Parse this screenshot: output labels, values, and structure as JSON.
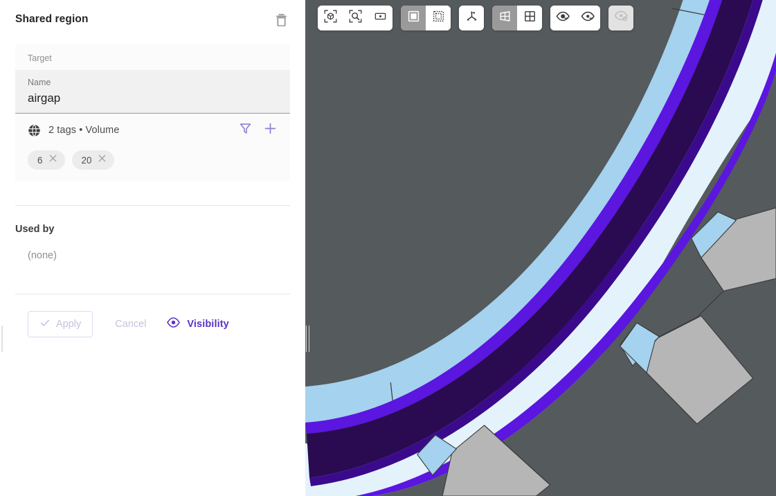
{
  "panel": {
    "title": "Shared region",
    "delete_icon": "trash-icon",
    "target_label": "Target",
    "name_label": "Name",
    "name_value": "airgap",
    "tags_icon": "globe-icon",
    "tags_summary": "2 tags • Volume",
    "filter_icon": "filter-icon",
    "add_icon": "plus-icon",
    "chips": [
      {
        "label": "6",
        "remove_icon": "close-icon"
      },
      {
        "label": "20",
        "remove_icon": "close-icon"
      }
    ],
    "used_by_title": "Used by",
    "used_by_value": "(none)",
    "apply_label": "Apply",
    "apply_icon": "check-icon",
    "cancel_label": "Cancel",
    "visibility_label": "Visibility",
    "visibility_icon": "eye-icon"
  },
  "toolbar": {
    "groups": [
      {
        "name": "view-fit-group",
        "buttons": [
          {
            "name": "fit-to-view-button",
            "icon": "cube-in-brackets-icon",
            "active": false,
            "disabled": false
          },
          {
            "name": "zoom-to-fit-button",
            "icon": "magnifier-in-brackets-icon",
            "active": false,
            "disabled": false
          },
          {
            "name": "viewport-box-button",
            "icon": "rect-with-dot-icon",
            "active": false,
            "disabled": false
          }
        ]
      },
      {
        "name": "selection-mode-group",
        "buttons": [
          {
            "name": "solid-select-button",
            "icon": "filled-square-icon",
            "active": true,
            "disabled": false
          },
          {
            "name": "marquee-select-button",
            "icon": "dotted-square-icon",
            "active": false,
            "disabled": false
          }
        ]
      },
      {
        "name": "axes-group",
        "buttons": [
          {
            "name": "axes-gizmo-button",
            "icon": "axes-tripod-icon",
            "active": false,
            "disabled": false
          }
        ]
      },
      {
        "name": "layout-group",
        "buttons": [
          {
            "name": "perspective-layout-button",
            "icon": "perspective-grid-icon",
            "active": true,
            "disabled": false
          },
          {
            "name": "quad-layout-button",
            "icon": "quad-grid-icon",
            "active": false,
            "disabled": false
          }
        ]
      },
      {
        "name": "visibility-group",
        "buttons": [
          {
            "name": "show-all-button",
            "icon": "eye-icon",
            "active": false,
            "disabled": false
          },
          {
            "name": "hide-all-button",
            "icon": "eye-dot-icon",
            "active": false,
            "disabled": false
          }
        ]
      },
      {
        "name": "isolate-group",
        "buttons": [
          {
            "name": "isolate-button",
            "icon": "eye-disabled-icon",
            "active": false,
            "disabled": true
          }
        ]
      }
    ]
  },
  "viewport": {
    "name": "3d-viewport",
    "colors": {
      "background": "#555a5c",
      "rotor_body": "#6a6e70",
      "stator_tooth": "#b6b6b6",
      "magnet_blue": "#a5d2ee",
      "airgap_fill": "#2a0b52",
      "airgap_edge": "#5b16e0",
      "gap_light": "#e4f2fc"
    }
  }
}
